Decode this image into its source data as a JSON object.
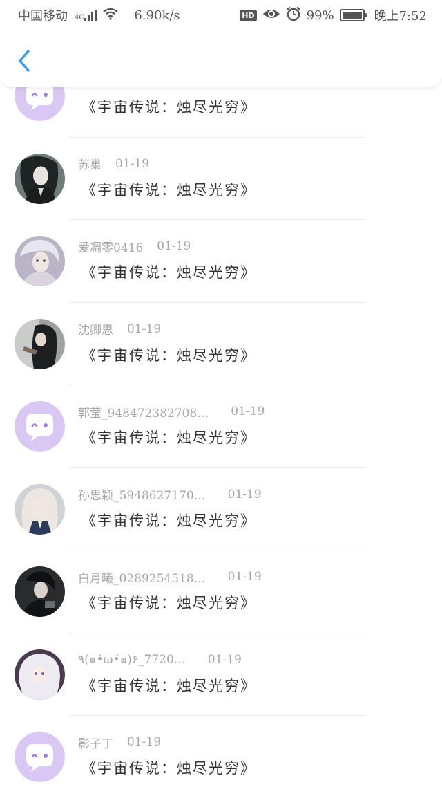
{
  "status_bar": {
    "carrier": "中国移动",
    "network": "4G",
    "speed": "6.90k/s",
    "hd_badge": "HD",
    "battery": "99%",
    "time": "晚上7:52",
    "icons": [
      "signal-icon",
      "wifi-icon",
      "hd-icon",
      "eye-icon",
      "alarm-icon",
      "battery-icon"
    ]
  },
  "header": {
    "back_icon": "chevron-left-icon",
    "accent_color": "#3b9fea"
  },
  "comments": [
    {
      "name": "",
      "date": "",
      "message": "《宇宙传说：烛尽光穷》",
      "avatar": "default-chat-avatar"
    },
    {
      "name": "苏巢",
      "date": "01-19",
      "message": "《宇宙传说：烛尽光穷》",
      "avatar": "photo-avatar"
    },
    {
      "name": "爱凋零0416",
      "date": "01-19",
      "message": "《宇宙传说：烛尽光穷》",
      "avatar": "photo-avatar"
    },
    {
      "name": "沈卿思",
      "date": "01-19",
      "message": "《宇宙传说：烛尽光穷》",
      "avatar": "photo-avatar"
    },
    {
      "name": "郭莹_948472382708…",
      "date": "01-19",
      "message": "《宇宙传说：烛尽光穷》",
      "avatar": "default-chat-avatar"
    },
    {
      "name": "孙思颖_5948627170…",
      "date": "01-19",
      "message": "《宇宙传说：烛尽光穷》",
      "avatar": "photo-avatar"
    },
    {
      "name": "白月曦_0289254518…",
      "date": "01-19",
      "message": "《宇宙传说：烛尽光穷》",
      "avatar": "photo-avatar"
    },
    {
      "name": "٩(๑•̀ω•́๑)۶_7720…",
      "date": "01-19",
      "message": "《宇宙传说：烛尽光穷》",
      "avatar": "photo-avatar"
    },
    {
      "name": "影子丁",
      "date": "01-19",
      "message": "《宇宙传说：烛尽光穷》",
      "avatar": "default-chat-avatar"
    }
  ],
  "colors": {
    "default_avatar_bg": "#d9c8f3",
    "default_avatar_bubble": "#ffffff",
    "default_avatar_mark": "#9d7fe0",
    "meta_text": "#a7a7a7",
    "message_text": "#333333"
  }
}
